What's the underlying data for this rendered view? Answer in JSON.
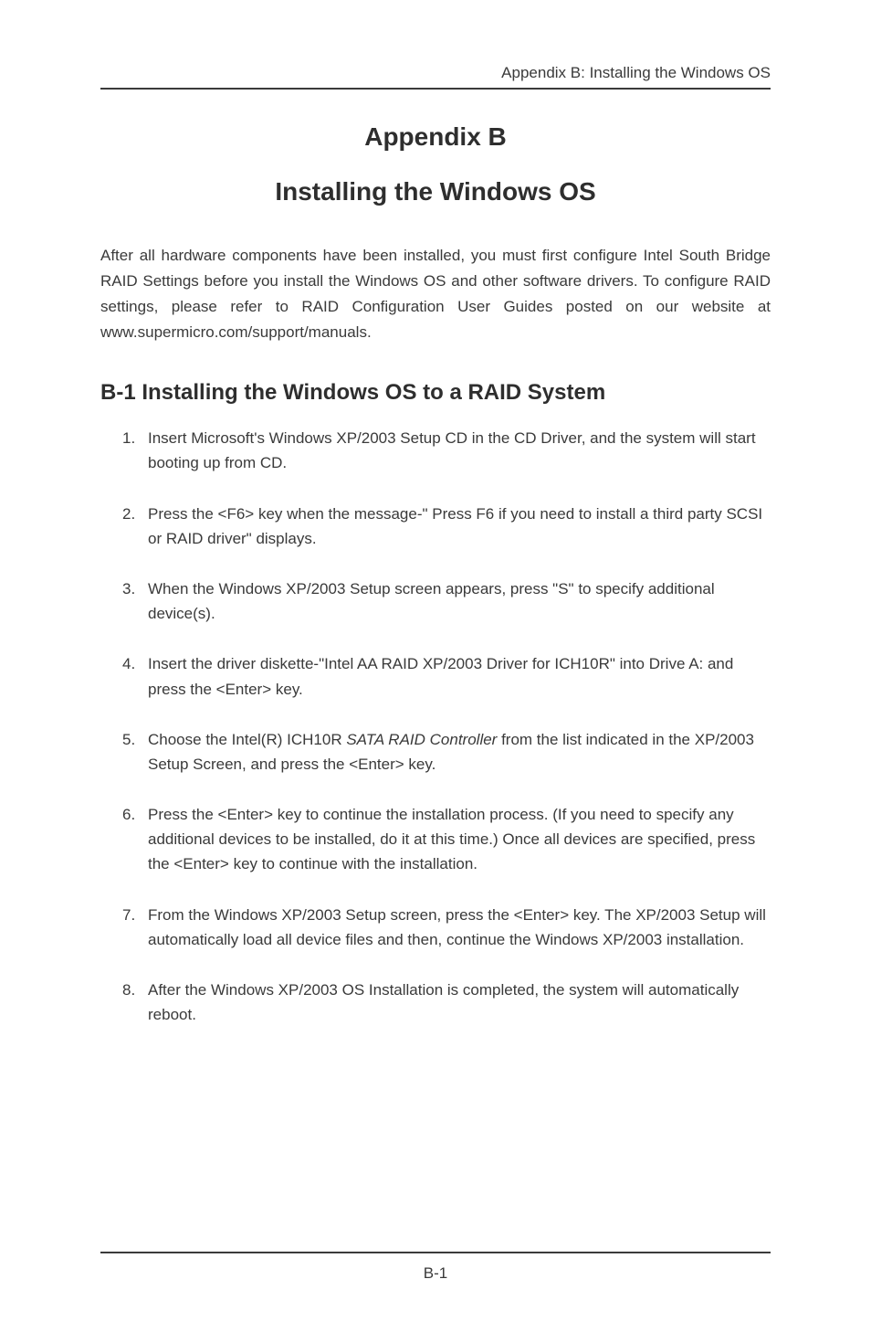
{
  "header": {
    "running_title": "Appendix B: Installing the Windows OS"
  },
  "titles": {
    "appendix": "Appendix B",
    "main": "Installing the Windows OS"
  },
  "intro": "After  all hardware components have been installed, you must first configure Intel South Bridge RAID Settings before you install the Windows OS and other software drivers. To configure RAID settings, please refer to RAID Configuration User Guides posted on our website at www.supermicro.com/support/manuals.",
  "section": {
    "heading": "B-1   Installing the Windows OS to a RAID System",
    "steps": [
      "Insert Microsoft's Windows XP/2003 Setup CD in the CD Driver, and the system will start booting up from CD.",
      "Press the <F6> key when the message-\" Press F6 if you need to install a third party SCSI or RAID driver\" displays.",
      "When the Windows XP/2003 Setup screen appears, press \"S\" to specify additional device(s).",
      "Insert the driver diskette-\"Intel AA RAID XP/2003 Driver for ICH10R\" into Drive A: and press the <Enter> key.",
      {
        "pre": "Choose the Intel(R) ICH10R ",
        "italic": "SATA RAID Controller",
        "post": " from the list indicated in the XP/2003 Setup Screen, and press the <Enter> key."
      },
      "Press the <Enter> key to continue the installation process. (If you need to specify any additional devices to be installed, do it at this time.) Once all devices are specified, press the <Enter> key to continue with the installation.",
      "From the Windows XP/2003 Setup screen, press the <Enter> key. The XP/2003 Setup will automatically load all device files and then, continue the Windows XP/2003 installation.",
      "After the Windows XP/2003 OS Installation is completed, the system will automatically reboot."
    ]
  },
  "footer": {
    "page": "B-1"
  }
}
